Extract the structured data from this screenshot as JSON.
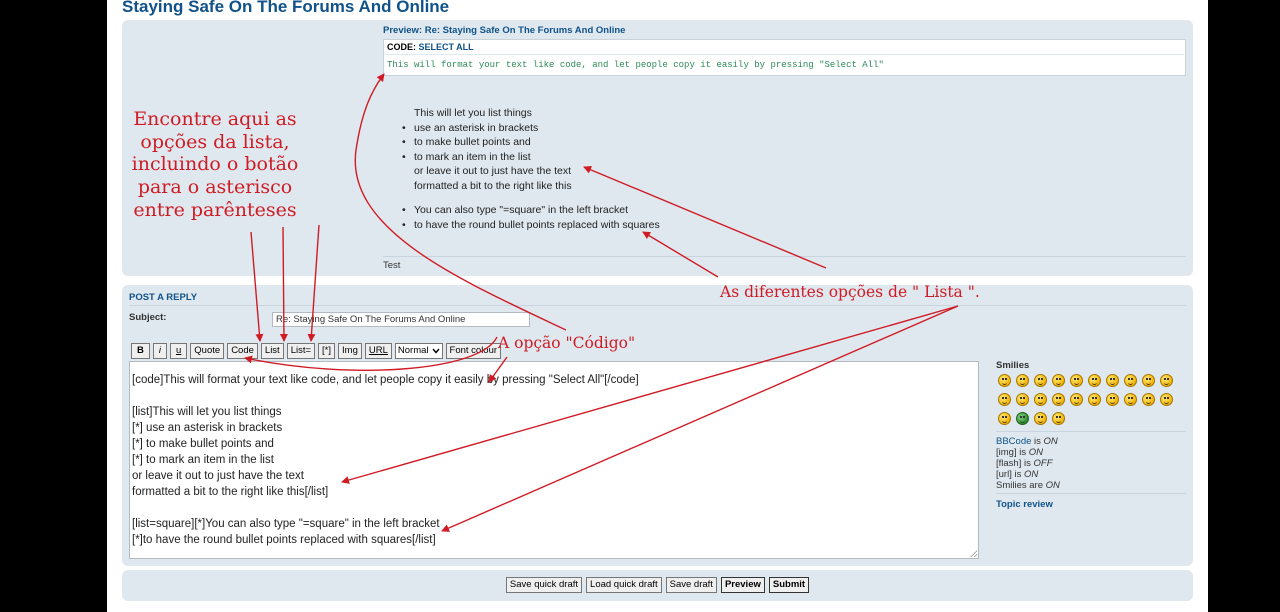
{
  "page_title": "Staying Safe On The Forums And Online",
  "preview": {
    "heading": "Preview: Re: Staying Safe On The Forums And Online",
    "code_label": "CODE:",
    "code_select_all": "SELECT ALL",
    "code_text": "This will format your text like code, and let people copy it easily by pressing \"Select All\"",
    "list1": [
      {
        "text": "This will let you list things",
        "bullet": false
      },
      {
        "text": "use an asterisk in brackets",
        "bullet": true
      },
      {
        "text": "to make bullet points and",
        "bullet": true
      },
      {
        "text": "to mark an item in the list",
        "bullet": true
      },
      {
        "text": "or leave it out to just have the text",
        "bullet": false
      },
      {
        "text": "formatted a bit to the right like this",
        "bullet": false
      }
    ],
    "list2": [
      {
        "text": "You can also type \"=square\" in the left bracket",
        "bullet": true
      },
      {
        "text": "to have the round bullet points replaced with squares",
        "bullet": true
      }
    ],
    "signature": "Test"
  },
  "reply": {
    "heading": "POST A REPLY",
    "subject_label": "Subject:",
    "subject_value": "Re: Staying Safe On The Forums And Online",
    "toolbar": {
      "bold": "B",
      "italic": "i",
      "underline": "u",
      "quote": "Quote",
      "code": "Code",
      "list": "List",
      "list_eq": "List=",
      "list_item": "[*]",
      "img": "Img",
      "url": "URL",
      "font_size": "Normal",
      "font_colour": "Font colour"
    },
    "message_lines": [
      "[code]This will format your text like code, and let people copy it easily by pressing \"Select All\"[/code]",
      "",
      "[list]This will let you list things",
      "[*] use an asterisk in brackets",
      "[*] to make bullet points and",
      "[*] to mark an item in the list",
      "or leave it out to just have the text",
      "formatted a bit to the right like this[/list]",
      "",
      "[list=square][*]You can also type \"=square\" in the left bracket",
      "[*]to have the round bullet points replaced with squares[/list]"
    ]
  },
  "sidebar": {
    "smilies_title": "Smilies",
    "bbcode_label": "BBCode",
    "bbcode_is": "is",
    "bbcode_state": "ON",
    "img_label": "[img] is",
    "img_state": "ON",
    "flash_label": "[flash] is",
    "flash_state": "OFF",
    "url_label": "[url] is",
    "url_state": "ON",
    "smilies_label": "Smilies are",
    "smilies_state": "ON",
    "topic_review": "Topic review"
  },
  "buttons": {
    "save_quick_draft": "Save quick draft",
    "load_quick_draft": "Load quick draft",
    "save_draft": "Save draft",
    "preview": "Preview",
    "submit": "Submit"
  },
  "annotations": {
    "list_options": [
      "Encontre aqui as",
      "opções da lista,",
      "incluindo o botão",
      "para o asterisco",
      "entre parênteses"
    ],
    "list_types": "As diferentes opções de  \" Lista \".",
    "code_option": "A opção \"Código\""
  },
  "colors": {
    "link_blue": "#105289",
    "panel_bg": "#dfe8ef",
    "code_green": "#2e8b57",
    "annotation_red": "#d01b24"
  }
}
